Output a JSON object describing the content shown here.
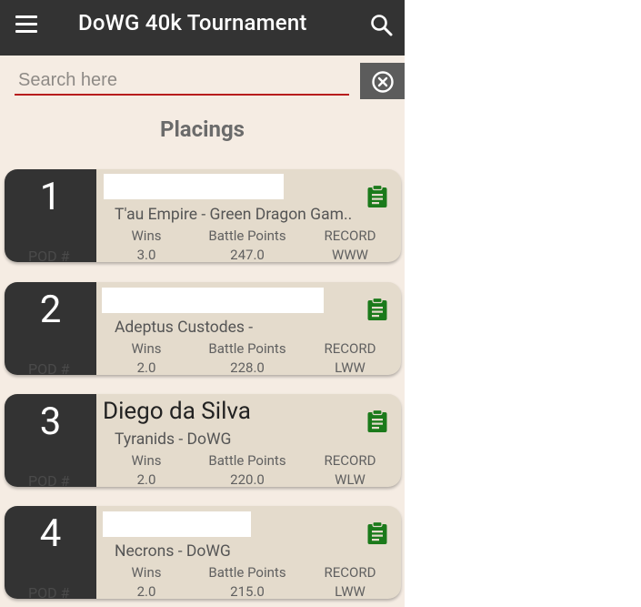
{
  "app_bar": {
    "title": "DoWG 40k Tournament",
    "menu_icon": "hamburger-menu-icon",
    "search_icon": "search-icon"
  },
  "search": {
    "placeholder": "Search here",
    "value": "",
    "clear_icon": "clear-circle-x-icon"
  },
  "section_title": "Placings",
  "stat_headers": {
    "wins": "Wins",
    "battle_points": "Battle Points",
    "record": "RECORD"
  },
  "pod_label": "POD #",
  "players": [
    {
      "rank": "1",
      "name": "",
      "army": "T'au Empire - Green Dragon Gam..",
      "wins": "3.0",
      "battle_points": "247.0",
      "record": "WWW"
    },
    {
      "rank": "2",
      "name": "",
      "army": "Adeptus Custodes -",
      "wins": "2.0",
      "battle_points": "228.0",
      "record": "LWW"
    },
    {
      "rank": "3",
      "name": "Diego da Silva",
      "army": "Tyranids - DoWG",
      "wins": "2.0",
      "battle_points": "220.0",
      "record": "WLW"
    },
    {
      "rank": "4",
      "name": "",
      "army": "Necrons - DoWG",
      "wins": "2.0",
      "battle_points": "215.0",
      "record": "LWW"
    }
  ],
  "colors": {
    "app_bar": "#333333",
    "background": "#f5ece3",
    "card": "#e4dbcc",
    "accent_red": "#b71c1c",
    "clipboard_green": "#1b7a1b"
  }
}
